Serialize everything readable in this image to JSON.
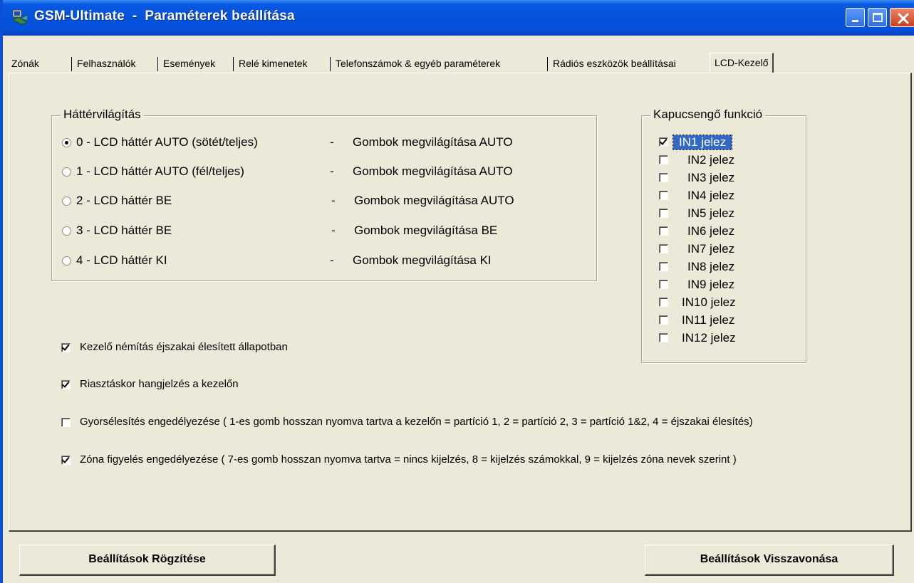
{
  "window": {
    "title": "GSM-Ultimate  -  Paraméterek beállítása"
  },
  "tabs": [
    {
      "label": "Zónák"
    },
    {
      "label": "Felhasználók"
    },
    {
      "label": "Események"
    },
    {
      "label": "Relé kimenetek"
    },
    {
      "label": "Telefonszámok & egyéb paraméterek"
    },
    {
      "label": "Rádiós eszközök beállításai"
    },
    {
      "label": "LCD-Kezelő"
    }
  ],
  "backlight": {
    "title": "Háttérvilágítás",
    "options": [
      {
        "lcd": "0 - LCD háttér AUTO (sötét/teljes)",
        "sep": "-",
        "buttons": "Gombok megvilágítása AUTO",
        "checked": true
      },
      {
        "lcd": "1 - LCD háttér AUTO (fél/teljes)",
        "sep": "-",
        "buttons": "Gombok megvilágítása AUTO",
        "checked": false
      },
      {
        "lcd": "2 - LCD háttér BE",
        "sep": "-",
        "buttons": "Gombok megvilágítása AUTO",
        "checked": false
      },
      {
        "lcd": "3 - LCD háttér BE",
        "sep": "-",
        "buttons": "Gombok megvilágítása BE",
        "checked": false
      },
      {
        "lcd": "4 - LCD háttér KI",
        "sep": "-",
        "buttons": "Gombok megvilágítása KI",
        "checked": false
      }
    ]
  },
  "doorbell": {
    "title": "Kapucsengő funkció",
    "items": [
      {
        "label": "IN1 jelez",
        "checked": true
      },
      {
        "label": "IN2 jelez",
        "checked": false
      },
      {
        "label": "IN3 jelez",
        "checked": false
      },
      {
        "label": "IN4 jelez",
        "checked": false
      },
      {
        "label": "IN5 jelez",
        "checked": false
      },
      {
        "label": "IN6 jelez",
        "checked": false
      },
      {
        "label": "IN7 jelez",
        "checked": false
      },
      {
        "label": "IN8 jelez",
        "checked": false
      },
      {
        "label": "IN9 jelez",
        "checked": false
      },
      {
        "label": "IN10 jelez",
        "checked": false
      },
      {
        "label": "IN11 jelez",
        "checked": false
      },
      {
        "label": "IN12 jelez",
        "checked": false
      }
    ]
  },
  "options": [
    {
      "label": "Kezelő némítás éjszakai élesített állapotban",
      "checked": true
    },
    {
      "label": "Riasztáskor hangjelzés a kezelőn",
      "checked": true
    },
    {
      "label": "Gyorsélesítés engedélyezése  ( 1-es gomb hosszan nyomva tartva a kezelőn = partíció 1,   2 = partíció 2,   3 = partíció 1&2,   4 = éjszakai élesítés)",
      "checked": false
    },
    {
      "label": "Zóna figyelés engedélyezése  ( 7-es gomb hosszan nyomva tartva = nincs kijelzés, 8 = kijelzés számokkal, 9 = kijelzés zóna nevek szerint )",
      "checked": true
    }
  ],
  "footer": {
    "save_label": "Beállítások Rögzítése",
    "revert_label": "Beállítások Visszavonása"
  },
  "colors": {
    "titlebar": "#0553d8",
    "face": "#ece9d8",
    "selection": "#316ac5"
  }
}
